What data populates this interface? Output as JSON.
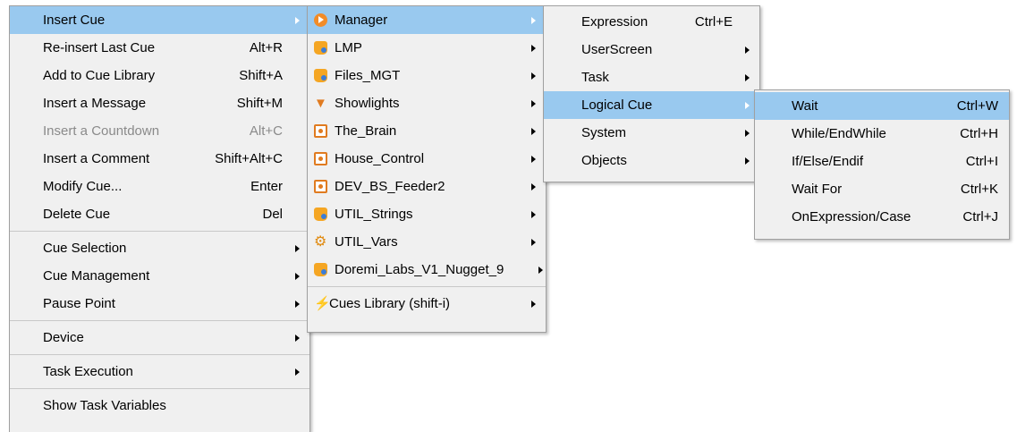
{
  "menu1": {
    "items": [
      {
        "label": "Insert Cue",
        "shortcut": "",
        "submenu": true,
        "highlighted": true
      },
      {
        "label": "Re-insert Last Cue",
        "shortcut": "Alt+R"
      },
      {
        "label": "Add to Cue Library",
        "shortcut": "Shift+A"
      },
      {
        "label": "Insert a Message",
        "shortcut": "Shift+M"
      },
      {
        "label": "Insert a Countdown",
        "shortcut": "Alt+C",
        "disabled": true
      },
      {
        "label": "Insert a Comment",
        "shortcut": "Shift+Alt+C"
      },
      {
        "label": "Modify Cue...",
        "shortcut": "Enter"
      },
      {
        "label": "Delete Cue",
        "shortcut": "Del"
      },
      {
        "label": "Cue Selection",
        "submenu": true
      },
      {
        "label": "Cue Management",
        "submenu": true
      },
      {
        "label": "Pause Point",
        "submenu": true
      },
      {
        "label": "Device",
        "submenu": true
      },
      {
        "label": "Task Execution",
        "submenu": true
      },
      {
        "label": "Show Task Variables"
      }
    ]
  },
  "menu2": {
    "items": [
      {
        "label": "Manager",
        "icon": "manager-play-icon",
        "highlighted": true
      },
      {
        "label": "LMP",
        "icon": "database-icon"
      },
      {
        "label": "Files_MGT",
        "icon": "database-icon"
      },
      {
        "label": "Showlights",
        "icon": "light-icon"
      },
      {
        "label": "The_Brain",
        "icon": "device-box-icon"
      },
      {
        "label": "House_Control",
        "icon": "device-box-icon"
      },
      {
        "label": "DEV_BS_Feeder2",
        "icon": "device-box-icon"
      },
      {
        "label": "UTIL_Strings",
        "icon": "database-icon"
      },
      {
        "label": "UTIL_Vars",
        "icon": "gear-icon"
      },
      {
        "label": "Doremi_Labs_V1_Nugget_9",
        "icon": "database-icon"
      },
      {
        "label": "Cues Library (shift-i)",
        "icon": "lightning-icon"
      }
    ]
  },
  "menu3": {
    "items": [
      {
        "label": "Expression",
        "shortcut": "Ctrl+E"
      },
      {
        "label": "UserScreen",
        "submenu": true
      },
      {
        "label": "Task",
        "submenu": true
      },
      {
        "label": "Logical Cue",
        "submenu": true,
        "highlighted": true
      },
      {
        "label": "System",
        "submenu": true
      },
      {
        "label": "Objects",
        "submenu": true
      }
    ]
  },
  "menu4": {
    "items": [
      {
        "label": "Wait",
        "shortcut": "Ctrl+W",
        "highlighted": true
      },
      {
        "label": "While/EndWhile",
        "shortcut": "Ctrl+H"
      },
      {
        "label": "If/Else/Endif",
        "shortcut": "Ctrl+I"
      },
      {
        "label": "Wait For",
        "shortcut": "Ctrl+K"
      },
      {
        "label": "OnExpression/Case",
        "shortcut": "Ctrl+J"
      }
    ]
  },
  "colors": {
    "menu_bg": "#f0f0f0",
    "highlight": "#99c9ef",
    "disabled_text": "#8a8a8a",
    "icon_orange": "#f28c28",
    "icon_blue": "#1a5fd0"
  }
}
